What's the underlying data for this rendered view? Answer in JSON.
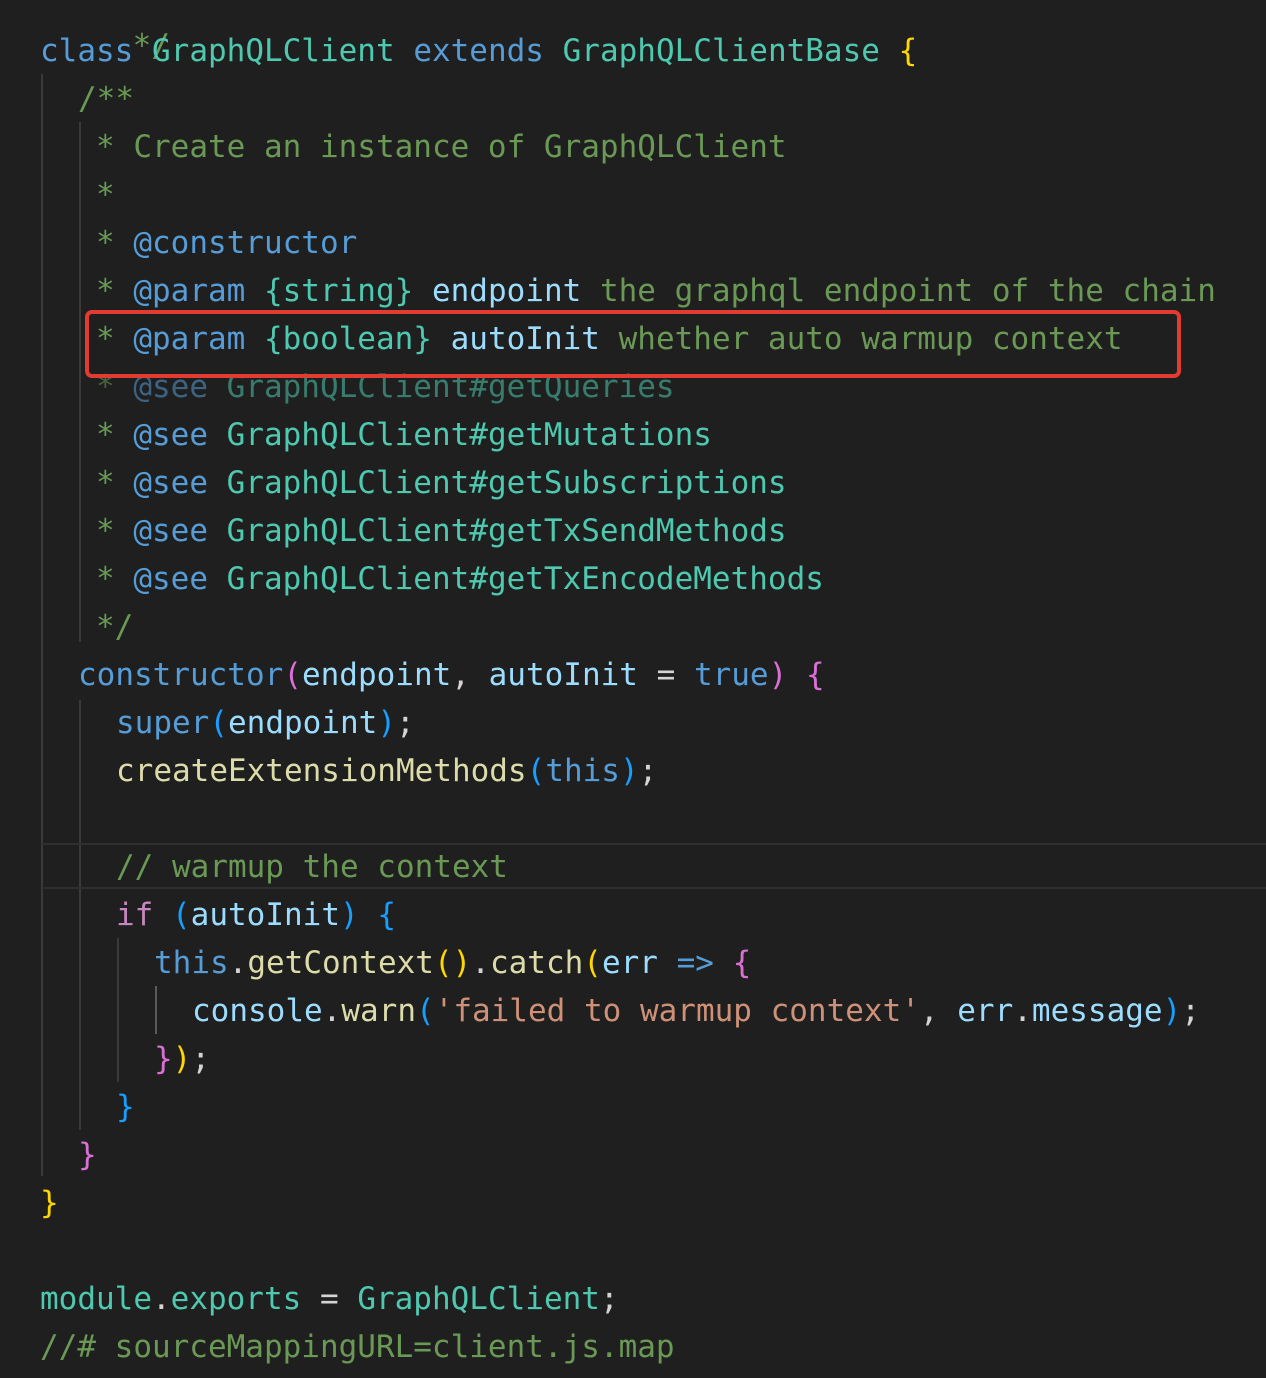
{
  "code": {
    "l0": "*/",
    "class_kw": "class",
    "class_name": "GraphQLClient",
    "extends_kw": "extends",
    "base_name": "GraphQLClientBase",
    "open_brace": "{",
    "doc_open": "/**",
    "doc_desc": "* Create an instance of GraphQLClient",
    "doc_star": "*",
    "doc_star_prefix": "* ",
    "constructor_tag": "@constructor",
    "param_tag": "@param",
    "string_type": "{string}",
    "endpoint_param": "endpoint",
    "endpoint_desc": "the graphql endpoint of the chain",
    "boolean_type": "{boolean}",
    "autoinit_param": "autoInit",
    "autoinit_desc": "whether auto warmup context",
    "see_tag": "@see",
    "see_queries": "GraphQLClient#getQueries",
    "see_mutations": "GraphQLClient#getMutations",
    "see_subscriptions": "GraphQLClient#getSubscriptions",
    "see_txsend": "GraphQLClient#getTxSendMethods",
    "see_txencode": "GraphQLClient#getTxEncodeMethods",
    "doc_close": "*/",
    "constructor_kw": "constructor",
    "endpoint_arg": "endpoint",
    "autoinit_arg": "autoInit",
    "true_kw": "true",
    "super_kw": "super",
    "create_ext_fn": "createExtensionMethods",
    "this_kw": "this",
    "warmup_comment": "// warmup the context",
    "if_kw": "if",
    "get_context_fn": "getContext",
    "catch_fn": "catch",
    "err_var": "err",
    "arrow": "=>",
    "console_obj": "console",
    "warn_fn": "warn",
    "warn_msg": "'failed to warmup context'",
    "message_prop": "message",
    "close_brace": "}",
    "module_obj": "module",
    "exports_prop": "exports",
    "export_value": "GraphQLClient",
    "sourcemap_comment": "//# sourceMappingURL=client.js.map"
  },
  "colors": {
    "background": "#1f1f1f",
    "highlight_border": "#e23b30"
  }
}
